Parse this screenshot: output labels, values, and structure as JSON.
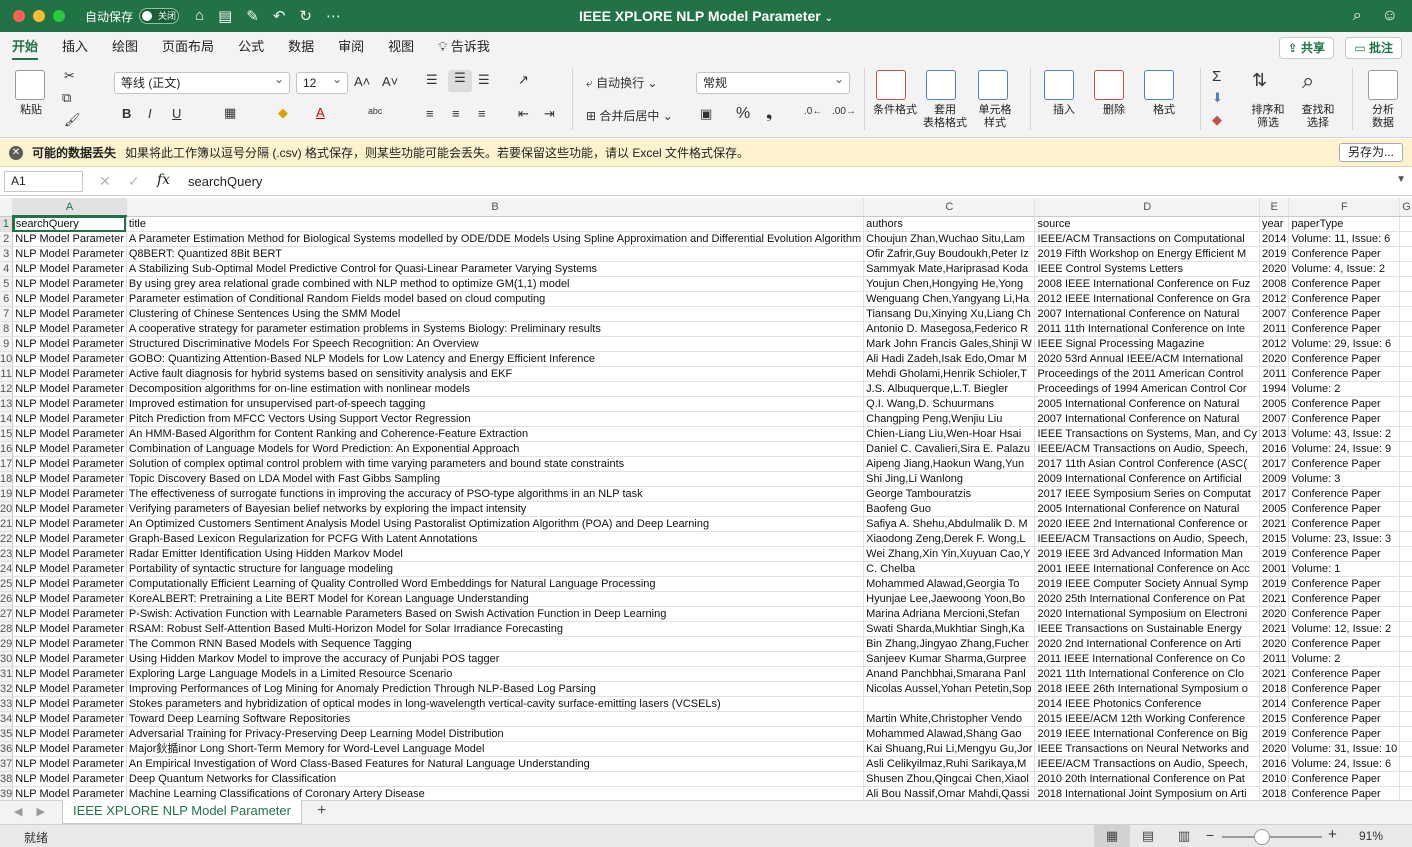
{
  "titlebar": {
    "autosave_label": "自动保存",
    "autosave_state": "关闭",
    "doc_title": "IEEE XPLORE NLP Model Parameter",
    "accent": "#217346"
  },
  "menu": {
    "tabs": [
      "开始",
      "插入",
      "绘图",
      "页面布局",
      "公式",
      "数据",
      "审阅",
      "视图"
    ],
    "tell_me": "告诉我",
    "share": "共享",
    "comments": "批注"
  },
  "ribbon": {
    "paste": "粘贴",
    "font_name": "等线 (正文)",
    "font_size": "12",
    "wrap_text": "自动换行",
    "merge_center": "合并后居中",
    "number_format": "常规",
    "conditional_format": "条件格式",
    "format_as_table_1": "套用",
    "format_as_table_2": "表格格式",
    "cell_styles_1": "单元格",
    "cell_styles_2": "样式",
    "insert": "插入",
    "delete": "删除",
    "format": "格式",
    "sort_filter_1": "排序和",
    "sort_filter_2": "筛选",
    "find_select_1": "查找和",
    "find_select_2": "选择",
    "analyze_1": "分析",
    "analyze_2": "数据"
  },
  "warning": {
    "title": "可能的数据丢失",
    "message": "如果将此工作簿以逗号分隔 (.csv) 格式保存，则某些功能可能会丢失。若要保留这些功能，请以 Excel 文件格式保存。",
    "button": "另存为..."
  },
  "formula_bar": {
    "name_box": "A1",
    "content": "searchQuery"
  },
  "grid": {
    "columns": [
      "A",
      "B",
      "C",
      "D",
      "E",
      "F",
      "G"
    ],
    "rows": [
      [
        "searchQuery",
        "title",
        "authors",
        "source",
        "year",
        "paperType"
      ],
      [
        "NLP Model Parameter",
        "A Parameter Estimation Method for Biological Systems modelled by ODE/DDE Models Using Spline Approximation and Differential Evolution Algorithm",
        "Choujun Zhan,Wuchao Situ,Lam",
        "IEEE/ACM Transactions on Computational",
        "2014",
        "Volume: 11, Issue: 6"
      ],
      [
        "NLP Model Parameter",
        "Q8BERT: Quantized 8Bit BERT",
        "Ofir Zafrir,Guy Boudoukh,Peter Iz",
        "2019 Fifth Workshop on Energy Efficient M",
        "2019",
        "Conference Paper"
      ],
      [
        "NLP Model Parameter",
        "A Stabilizing Sub-Optimal Model Predictive Control for Quasi-Linear Parameter Varying Systems",
        "Sammyak Mate,Hariprasad Koda",
        "IEEE Control Systems Letters",
        "2020",
        "Volume: 4, Issue: 2"
      ],
      [
        "NLP Model Parameter",
        "By using grey area relational grade combined with NLP method to optimize GM(1,1) model",
        "Youjun Chen,Hongying He,Yong",
        "2008 IEEE International Conference on Fuz",
        "2008",
        "Conference Paper"
      ],
      [
        "NLP Model Parameter",
        "Parameter estimation of Conditional Random Fields model based on cloud computing",
        "Wenguang Chen,Yangyang Li,Ha",
        "2012 IEEE International Conference on Gra",
        "2012",
        "Conference Paper"
      ],
      [
        "NLP Model Parameter",
        "Clustering of Chinese Sentences Using the SMM Model",
        "Tiansang Du,Xinying Xu,Liang Ch",
        "2007 International Conference on Natural",
        "2007",
        "Conference Paper"
      ],
      [
        "NLP Model Parameter",
        "A cooperative strategy for parameter estimation problems in Systems Biology: Preliminary results",
        "Antonio D. Masegosa,Federico R",
        "2011 11th International Conference on Inte",
        "2011",
        "Conference Paper"
      ],
      [
        "NLP Model Parameter",
        "Structured Discriminative Models For Speech Recognition: An Overview",
        "Mark John Francis Gales,Shinji W",
        "IEEE Signal Processing Magazine",
        "2012",
        "Volume: 29, Issue: 6"
      ],
      [
        "NLP Model Parameter",
        "GOBO: Quantizing Attention-Based NLP Models for Low Latency and Energy Efficient Inference",
        "Ali Hadi Zadeh,Isak Edo,Omar M",
        "2020 53rd Annual IEEE/ACM International",
        "2020",
        "Conference Paper"
      ],
      [
        "NLP Model Parameter",
        "Active fault diagnosis for hybrid systems based on sensitivity analysis and EKF",
        "Mehdi Gholami,Henrik Schioler,T",
        "Proceedings of the 2011 American Control",
        "2011",
        "Conference Paper"
      ],
      [
        "NLP Model Parameter",
        "Decomposition algorithms for on-line estimation with nonlinear models",
        "J.S. Albuquerque,L.T. Biegler",
        "Proceedings of 1994 American Control Cor",
        "1994",
        "Volume: 2"
      ],
      [
        "NLP Model Parameter",
        "Improved estimation for unsupervised part-of-speech tagging",
        "Q.I. Wang,D. Schuurmans",
        "2005 International Conference on Natural",
        "2005",
        "Conference Paper"
      ],
      [
        "NLP Model Parameter",
        "Pitch Prediction from MFCC Vectors Using Support Vector Regression",
        "Changping Peng,Wenjiu Liu",
        "2007 International Conference on Natural",
        "2007",
        "Conference Paper"
      ],
      [
        "NLP Model Parameter",
        "An HMM-Based Algorithm for Content Ranking and Coherence-Feature Extraction",
        "Chien-Liang Liu,Wen-Hoar Hsai",
        "IEEE Transactions on Systems, Man, and Cy",
        "2013",
        "Volume: 43, Issue: 2"
      ],
      [
        "NLP Model Parameter",
        "Combination of Language Models for Word Prediction: An Exponential Approach",
        "Daniel C. Cavalieri,Sira E. Palazu",
        "IEEE/ACM Transactions on Audio, Speech,",
        "2016",
        "Volume: 24, Issue: 9"
      ],
      [
        "NLP Model Parameter",
        "Solution of complex optimal control problem with time varying parameters and bound state constraints",
        "Aipeng Jiang,Haokun Wang,Yun",
        "2017 11th Asian Control Conference (ASC(",
        "2017",
        "Conference Paper"
      ],
      [
        "NLP Model Parameter",
        "Topic Discovery Based on LDA Model with Fast Gibbs Sampling",
        "Shi Jing,Li Wanlong",
        "2009 International Conference on Artificial",
        "2009",
        "Volume: 3"
      ],
      [
        "NLP Model Parameter",
        "The effectiveness of surrogate functions in improving the accuracy of PSO-type algorithms in an NLP task",
        "George Tambouratzis",
        "2017 IEEE Symposium Series on Computat",
        "2017",
        "Conference Paper"
      ],
      [
        "NLP Model Parameter",
        "Verifying parameters of Bayesian belief networks by exploring the impact intensity",
        "Baofeng Guo",
        "2005 International Conference on Natural",
        "2005",
        "Conference Paper"
      ],
      [
        "NLP Model Parameter",
        "An Optimized Customers Sentiment Analysis Model Using Pastoralist Optimization Algorithm (POA) and Deep Learning",
        "Safiya A. Shehu,Abdulmalik D. M",
        "2020 IEEE 2nd International Conference or",
        "2021",
        "Conference Paper"
      ],
      [
        "NLP Model Parameter",
        "Graph-Based Lexicon Regularization for PCFG With Latent Annotations",
        "Xiaodong Zeng,Derek F. Wong,L",
        "IEEE/ACM Transactions on Audio, Speech,",
        "2015",
        "Volume: 23, Issue: 3"
      ],
      [
        "NLP Model Parameter",
        "Radar Emitter Identification Using Hidden Markov Model",
        "Wei Zhang,Xin Yin,Xuyuan Cao,Y",
        "2019 IEEE 3rd Advanced Information Man",
        "2019",
        "Conference Paper"
      ],
      [
        "NLP Model Parameter",
        "Portability of syntactic structure for language modeling",
        "C. Chelba",
        "2001 IEEE International Conference on Acc",
        "2001",
        "Volume: 1"
      ],
      [
        "NLP Model Parameter",
        "Computationally Efficient Learning of Quality Controlled Word Embeddings for Natural Language Processing",
        "Mohammed Alawad,Georgia To",
        "2019 IEEE Computer Society Annual Symp",
        "2019",
        "Conference Paper"
      ],
      [
        "NLP Model Parameter",
        "KoreALBERT: Pretraining a Lite BERT Model for Korean Language Understanding",
        "Hyunjae Lee,Jaewoong Yoon,Bo",
        "2020 25th International Conference on Pat",
        "2021",
        "Conference Paper"
      ],
      [
        "NLP Model Parameter",
        "P-Swish: Activation Function with Learnable Parameters Based on Swish Activation Function in Deep Learning",
        "Marina Adriana Mercioni,Stefan",
        "2020 International Symposium on Electroni",
        "2020",
        "Conference Paper"
      ],
      [
        "NLP Model Parameter",
        "RSAM: Robust Self-Attention Based Multi-Horizon Model for Solar Irradiance Forecasting",
        "Swati Sharda,Mukhtiar Singh,Ka",
        "IEEE Transactions on Sustainable Energy",
        "2021",
        "Volume: 12, Issue: 2"
      ],
      [
        "NLP Model Parameter",
        "The Common RNN Based Models with Sequence Tagging",
        "Bin Zhang,Jingyao Zhang,Fucher",
        "2020 2nd International Conference on Arti",
        "2020",
        "Conference Paper"
      ],
      [
        "NLP Model Parameter",
        "Using Hidden Markov Model to improve the accuracy of Punjabi POS tagger",
        "Sanjeev Kumar Sharma,Gurpree",
        "2011 IEEE International Conference on Co",
        "2011",
        "Volume: 2"
      ],
      [
        "NLP Model Parameter",
        "Exploring Large Language Models in a Limited Resource Scenario",
        "Anand Panchbhai,Smarana Panl",
        "2021 11th International Conference on Clo",
        "2021",
        "Conference Paper"
      ],
      [
        "NLP Model Parameter",
        "Improving Performances of Log Mining for Anomaly Prediction Through NLP-Based Log Parsing",
        "Nicolas Aussel,Yohan Petetin,Sop",
        "2018 IEEE 26th International Symposium o",
        "2018",
        "Conference Paper"
      ],
      [
        "NLP Model Parameter",
        "Stokes parameters and hybridization of optical modes in long-wavelength vertical-cavity surface-emitting lasers (VCSELs)",
        "",
        "2014 IEEE Photonics Conference",
        "2014",
        "Conference Paper"
      ],
      [
        "NLP Model Parameter",
        "Toward Deep Learning Software Repositories",
        "Martin White,Christopher Vendo",
        "2015 IEEE/ACM 12th Working Conference",
        "2015",
        "Conference Paper"
      ],
      [
        "NLP Model Parameter",
        "Adversarial Training for Privacy-Preserving Deep Learning Model Distribution",
        "Mohammed Alawad,Shang Gao",
        "2019 IEEE International Conference on Big",
        "2019",
        "Conference Paper"
      ],
      [
        "NLP Model Parameter",
        "Major鈥揗inor Long Short-Term Memory for Word-Level Language Model",
        "Kai Shuang,Rui Li,Mengyu Gu,Jor",
        "IEEE Transactions on Neural Networks and",
        "2020",
        "Volume: 31, Issue: 10"
      ],
      [
        "NLP Model Parameter",
        "An Empirical Investigation of Word Class-Based Features for Natural Language Understanding",
        "Asli Celikyilmaz,Ruhi Sarikaya,M",
        "IEEE/ACM Transactions on Audio, Speech,",
        "2016",
        "Volume: 24, Issue: 6"
      ],
      [
        "NLP Model Parameter",
        "Deep Quantum Networks for Classification",
        "Shusen Zhou,Qingcai Chen,Xiaol",
        "2010 20th International Conference on Pat",
        "2010",
        "Conference Paper"
      ],
      [
        "NLP Model Parameter",
        "Machine Learning Classifications of Coronary Artery Disease",
        "Ali Bou Nassif,Omar Mahdi,Qassi",
        "2018 International Joint Symposium on Arti",
        "2018",
        "Conference Paper"
      ]
    ]
  },
  "sheet_tabs": {
    "active": "IEEE XPLORE NLP Model Parameter",
    "add": "+"
  },
  "statusbar": {
    "status": "就绪",
    "zoom": "91%",
    "zoom_level": 0.4
  }
}
